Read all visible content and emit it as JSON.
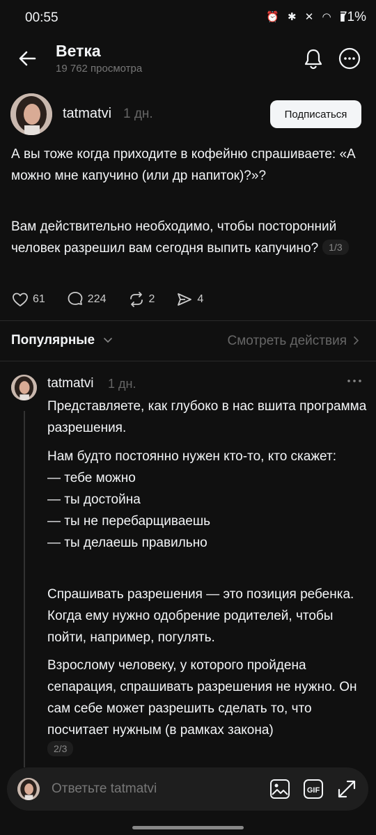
{
  "status_bar": {
    "time": "00:55",
    "battery": "71%"
  },
  "header": {
    "title": "Ветка",
    "views": "19 762 просмотра"
  },
  "post": {
    "username": "tatmatvi",
    "ago": "1 дн.",
    "subscribe_label": "Подписаться",
    "paragraph1": "А вы тоже когда приходите в кофейню спрашиваете: «А можно мне капучино (или др напиток)?»?",
    "paragraph2": "Вам действительно необходимо, чтобы посторонний человек разрешил вам сегодня выпить капучино?",
    "page_indicator": "1/3",
    "likes": "61",
    "comments": "224",
    "reposts": "2",
    "shares": "4"
  },
  "sort": {
    "label": "Популярные",
    "activity_link": "Смотреть действия"
  },
  "reply": {
    "username": "tatmatvi",
    "ago": "1 дн.",
    "paragraph1": "Представляете, как глубоко в нас вшита программа разрешения.",
    "paragraph2_lines": [
      "Нам будто постоянно нужен кто-то, кто скажет:",
      "— тебе можно",
      "— ты достойна",
      "— ты не перебарщиваешь",
      "— ты делаешь правильно"
    ],
    "paragraph3": "Спрашивать разрешения — это позиция ребенка. Когда ему нужно одобрение родителей, чтобы пойти, например, погулять.",
    "paragraph4": "Взрослому человеку, у которого пройдена сепарация, спрашивать разрешения не нужно. Он сам себе может разрешить сделать то, что посчитает нужным (в рамках закона)",
    "page_indicator": "2/3"
  },
  "composer": {
    "placeholder": "Ответьте tatmatvi",
    "gif_label": "GIF"
  }
}
